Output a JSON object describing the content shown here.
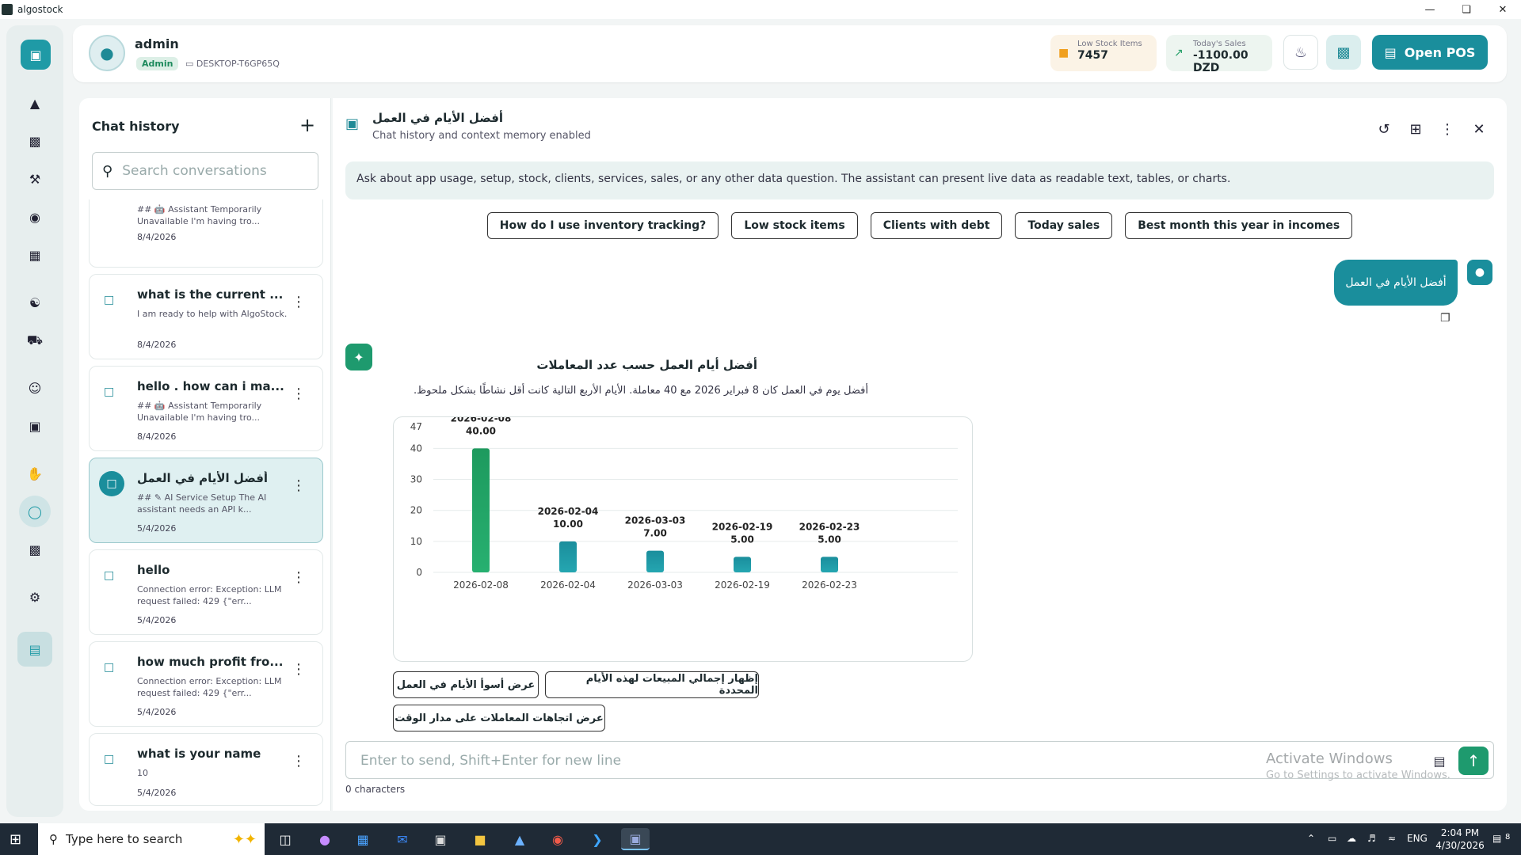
{
  "window": {
    "title": "algostock"
  },
  "user": {
    "name": "admin",
    "role": "Admin",
    "device": "DESKTOP-T6GP65Q"
  },
  "stats": {
    "low_stock": {
      "label": "Low Stock Items",
      "value": "7457"
    },
    "today_sales": {
      "label": "Today's Sales",
      "value": "-1100.00 DZD"
    }
  },
  "topbar": {
    "open_pos": "Open POS"
  },
  "history": {
    "title": "Chat history",
    "search_placeholder": "Search conversations",
    "items": [
      {
        "title": "",
        "preview": "## 🤖 Assistant Temporarily Unavailable I'm having tro...",
        "date": "8/4/2026"
      },
      {
        "title": "what is the current ...",
        "preview": "I am ready to help with AlgoStock.",
        "date": "8/4/2026"
      },
      {
        "title": "hello . how can i ma...",
        "preview": "## 🤖 Assistant Temporarily Unavailable I'm having tro...",
        "date": "8/4/2026"
      },
      {
        "title": "أفضل الأيام في العمل",
        "preview": "## ✎ AI Service Setup The AI assistant needs an API k...",
        "date": "5/4/2026"
      },
      {
        "title": "hello",
        "preview": "Connection error: Exception: LLM request failed: 429 {\"err...",
        "date": "5/4/2026"
      },
      {
        "title": "how much profit fro...",
        "preview": "Connection error: Exception: LLM request failed: 429 {\"err...",
        "date": "5/4/2026"
      },
      {
        "title": "what is your name",
        "preview": "10",
        "date": "5/4/2026"
      }
    ]
  },
  "chat": {
    "title": "أفضل الأيام في العمل",
    "subtitle": "Chat history and context memory enabled",
    "banner": "Ask about app usage, setup, stock, clients, services, sales, or any other data question. The assistant can present live data as readable text, tables, or charts.",
    "quick_prompts": [
      "How do I use inventory tracking?",
      "Low stock items",
      "Clients with debt",
      "Today sales",
      "Best month this year in incomes"
    ],
    "user_message": "أفضل الأيام في العمل",
    "answer_title": "أفضل أيام العمل حسب عدد المعاملات",
    "answer_text": "أفضل يوم في العمل كان 8 فبراير 2026 مع 40 معاملة. الأيام الأربع التالية كانت أقل نشاطًا بشكل ملحوظ.",
    "suggestions": [
      "عرض أسوأ الأيام في العمل",
      "إظهار إجمالي المبيعات لهذه الأيام المحددة",
      "عرض اتجاهات المعاملات على مدار الوقت"
    ],
    "input_placeholder": "Enter to send, Shift+Enter for new line",
    "char_count": "0 characters"
  },
  "chart_data": {
    "type": "bar",
    "categories": [
      "2026-02-08",
      "2026-02-04",
      "2026-03-03",
      "2026-02-19",
      "2026-02-23"
    ],
    "values": [
      40,
      10,
      7,
      5,
      5
    ],
    "data_labels": [
      "2026-02-08\n40.00",
      "2026-02-04\n10.00",
      "2026-03-03\n7.00",
      "2026-02-19\n5.00",
      "2026-02-23\n5.00"
    ],
    "yticks": [
      0,
      10,
      20,
      30,
      40,
      47
    ],
    "ylim": [
      0,
      47
    ],
    "grid": true,
    "colors": {
      "top": "#1e9a5e",
      "rest": "#1a8e9c"
    }
  },
  "watermark": {
    "line1": "Activate Windows",
    "line2": "Go to Settings to activate Windows."
  },
  "taskbar": {
    "search_placeholder": "Type here to search",
    "language": "ENG",
    "time": "2:04 PM",
    "date": "4/30/2026",
    "notifications": "8"
  },
  "colors": {
    "accent": "#1a8e9c",
    "success": "#1e9a6e",
    "warning": "#f0a020"
  }
}
